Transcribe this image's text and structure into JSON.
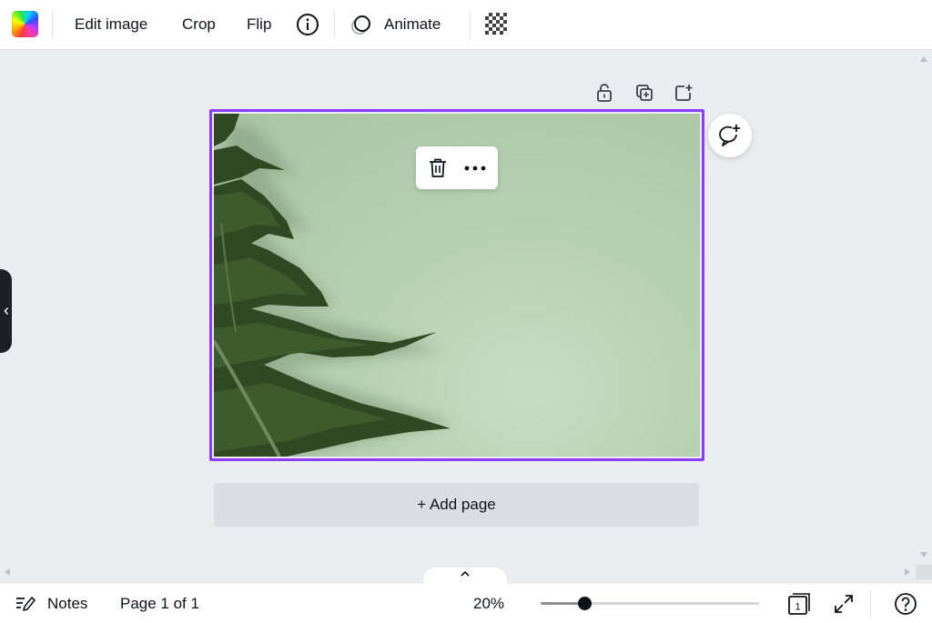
{
  "toolbar": {
    "color_swatch": "color-picker",
    "edit_image_label": "Edit image",
    "crop_label": "Crop",
    "flip_label": "Flip",
    "info_icon": "info-icon",
    "animate_label": "Animate",
    "transparency_icon": "transparency-icon"
  },
  "page_tools": {
    "lock_icon": "unlock-icon",
    "duplicate_icon": "duplicate-page-icon",
    "add_icon": "add-page-icon"
  },
  "context_menu": {
    "delete_icon": "trash-icon",
    "more_icon": "more-icon"
  },
  "comment": {
    "icon": "add-comment-icon"
  },
  "add_page": {
    "label": "+ Add page"
  },
  "bottom": {
    "notes_label": "Notes",
    "page_indicator": "Page 1 of 1",
    "zoom_label": "20%",
    "zoom_value": 0.2,
    "page_count_badge": "1",
    "fullscreen_icon": "fullscreen-icon",
    "help_icon": "help-icon"
  },
  "colors": {
    "accent": "#8b3dff",
    "toolbar_bg": "#ffffff",
    "canvas_bg": "#ebecf0",
    "text": "#0e1318"
  }
}
